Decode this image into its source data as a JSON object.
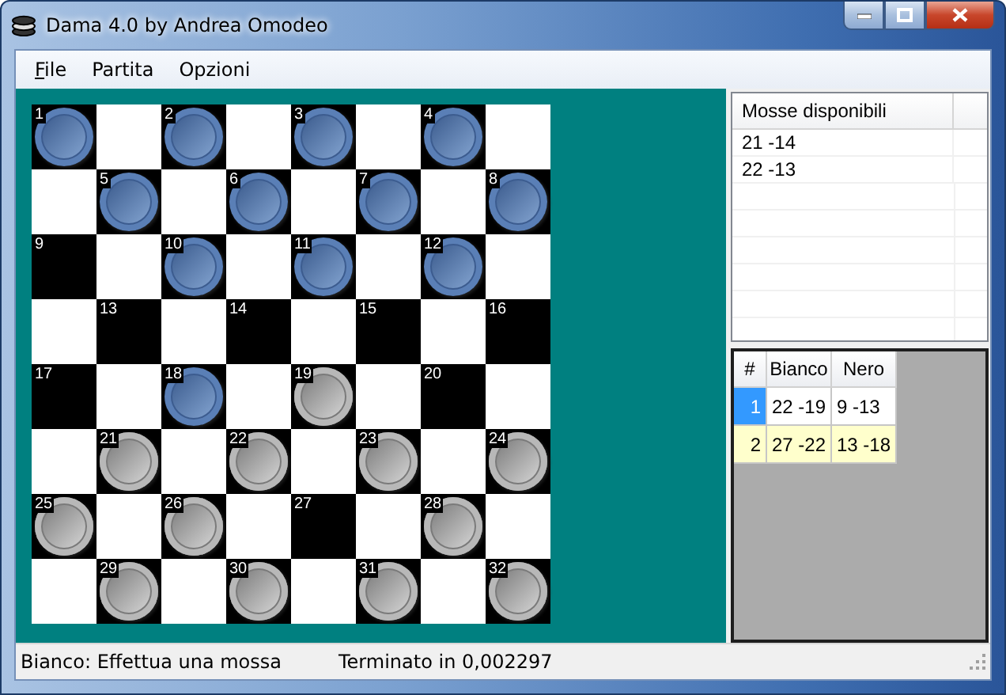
{
  "window": {
    "title": "Dama 4.0 by Andrea Omodeo"
  },
  "menu": [
    {
      "label": "File",
      "mnemonic": true
    },
    {
      "label": "Partita",
      "mnemonic": false
    },
    {
      "label": "Opzioni",
      "mnemonic": false
    }
  ],
  "board": {
    "squares": [
      {
        "number": "1",
        "kind": "blue"
      },
      {
        "number": "2",
        "kind": "blue"
      },
      {
        "number": "3",
        "kind": "blue"
      },
      {
        "number": "4",
        "kind": "blue"
      },
      {
        "number": "5",
        "kind": "blue"
      },
      {
        "number": "6",
        "kind": "blue"
      },
      {
        "number": "7",
        "kind": "blue"
      },
      {
        "number": "8",
        "kind": "blue"
      },
      {
        "number": "9",
        "kind": "empty"
      },
      {
        "number": "10",
        "kind": "blue"
      },
      {
        "number": "11",
        "kind": "blue"
      },
      {
        "number": "12",
        "kind": "blue"
      },
      {
        "number": "13",
        "kind": "empty"
      },
      {
        "number": "14",
        "kind": "empty"
      },
      {
        "number": "15",
        "kind": "empty"
      },
      {
        "number": "16",
        "kind": "empty"
      },
      {
        "number": "17",
        "kind": "empty"
      },
      {
        "number": "18",
        "kind": "blue"
      },
      {
        "number": "19",
        "kind": "white"
      },
      {
        "number": "20",
        "kind": "empty"
      },
      {
        "number": "21",
        "kind": "white"
      },
      {
        "number": "22",
        "kind": "white"
      },
      {
        "number": "23",
        "kind": "white"
      },
      {
        "number": "24",
        "kind": "white"
      },
      {
        "number": "25",
        "kind": "white"
      },
      {
        "number": "26",
        "kind": "white"
      },
      {
        "number": "27",
        "kind": "empty"
      },
      {
        "number": "28",
        "kind": "white"
      },
      {
        "number": "29",
        "kind": "white"
      },
      {
        "number": "30",
        "kind": "white"
      },
      {
        "number": "31",
        "kind": "white"
      },
      {
        "number": "32",
        "kind": "white"
      }
    ]
  },
  "moves_list": {
    "columns": [
      "Mosse disponibili"
    ],
    "rows": [
      "21 -14",
      "22 -13"
    ]
  },
  "history": {
    "columns": [
      "#",
      "Bianco",
      "Nero"
    ],
    "rows": [
      {
        "index": "1",
        "bianco": "22 -19",
        "nero": "9 -13",
        "selected": true
      },
      {
        "index": "2",
        "bianco": "27 -22",
        "nero": "13 -18",
        "selected": false
      }
    ]
  },
  "status_bar": [
    "Bianco: Effettua una mossa",
    "Terminato in 0,002297"
  ]
}
